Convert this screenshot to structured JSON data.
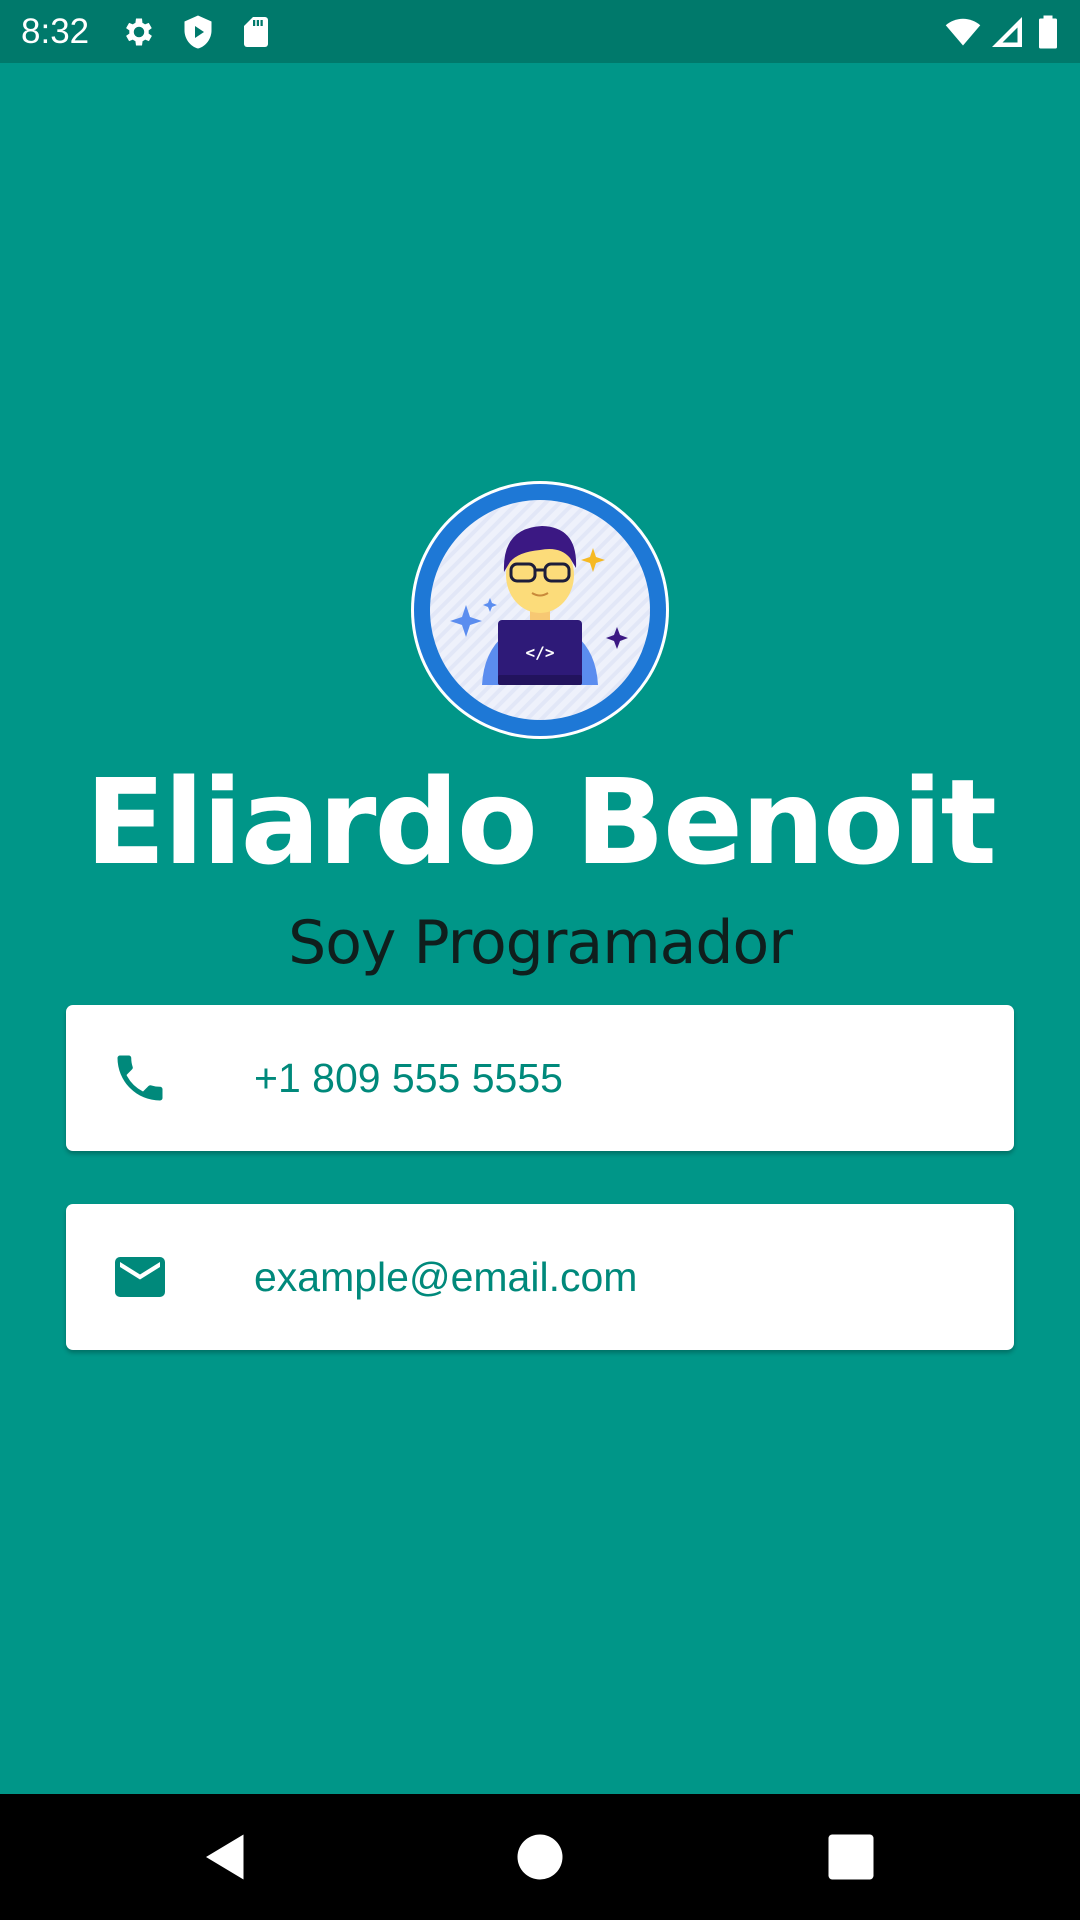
{
  "status_bar": {
    "time": "8:32",
    "icons_left": [
      "gear-icon",
      "shield-play-icon",
      "sd-card-icon"
    ],
    "icons_right": [
      "wifi-icon",
      "cell-signal-icon",
      "battery-icon"
    ]
  },
  "profile": {
    "avatar_icon": "programmer-avatar-icon",
    "avatar_code_text": "</>",
    "name": "Eliardo Benoit",
    "title": "Soy Programador"
  },
  "contacts": {
    "phone": {
      "icon": "phone-icon",
      "value": "+1 809 555 5555"
    },
    "email": {
      "icon": "mail-icon",
      "value": "example@email.com"
    }
  },
  "nav_bar": {
    "buttons": [
      "back-icon",
      "home-icon",
      "recents-icon"
    ]
  },
  "colors": {
    "background": "#009688",
    "status_bar": "#00796B",
    "accent_text": "#00897B",
    "card": "#FFFFFF",
    "avatar_ring": "#1E78D6"
  }
}
